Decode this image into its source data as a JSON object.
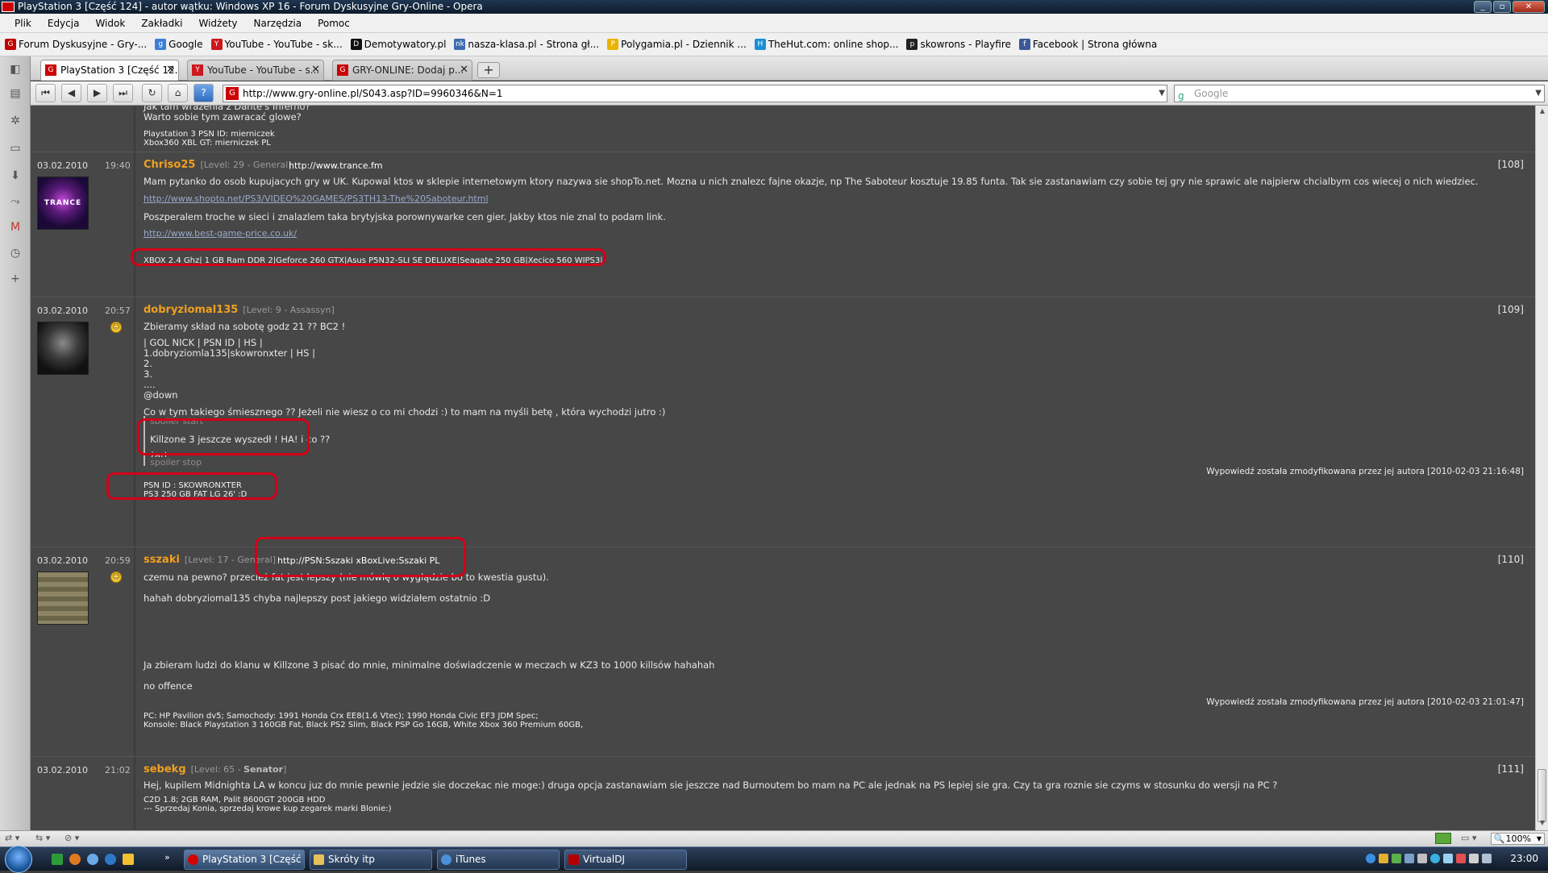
{
  "window": {
    "title": "PlayStation 3 [Część 124] - autor wątku: Windows XP 16 - Forum Dyskusyjne Gry-Online - Opera",
    "controls": [
      "_",
      "▫",
      "✕"
    ]
  },
  "menu": [
    "Plik",
    "Edycja",
    "Widok",
    "Zakładki",
    "Widżety",
    "Narzędzia",
    "Pomoc"
  ],
  "bookmarks": [
    {
      "label": "Forum Dyskusyjne - Gry-...",
      "icon": "gry-online-icon",
      "color": "#c00000"
    },
    {
      "label": "Google",
      "icon": "google-icon",
      "color": "#3a7fd5"
    },
    {
      "label": "YouTube - YouTube - sk...",
      "icon": "youtube-icon",
      "color": "#cc181e"
    },
    {
      "label": "Demotywatory.pl",
      "icon": "demotywatory-icon",
      "color": "#111111"
    },
    {
      "label": "nasza-klasa.pl - Strona gł...",
      "icon": "nk-icon",
      "color": "#3c6bb0"
    },
    {
      "label": "Polygamia.pl - Dziennik ...",
      "icon": "polygamia-icon",
      "color": "#e8b400"
    },
    {
      "label": "TheHut.com: online shop...",
      "icon": "thehut-icon",
      "color": "#1a8fd8"
    },
    {
      "label": "skowrons - Playfire",
      "icon": "playfire-icon",
      "color": "#222222"
    },
    {
      "label": "Facebook | Strona główna",
      "icon": "facebook-icon",
      "color": "#3b5998"
    }
  ],
  "tabs": [
    {
      "label": "PlayStation 3 [Część 12...",
      "active": true
    },
    {
      "label": "YouTube - YouTube - s...",
      "active": false
    },
    {
      "label": "GRY-ONLINE: Dodaj p...",
      "active": false
    }
  ],
  "address": {
    "url": "http://www.gry-online.pl/S043.asp?ID=9960346&N=1",
    "search_placeholder": "Google"
  },
  "top_partial": {
    "lines": "Jak tam wrażenia z Dante's Inferno?\nWarto sobie tym zawracać glowe?",
    "sig": "Playstation 3 PSN ID: mierniczek\nXbox360 XBL GT: mierniczek PL"
  },
  "posts": [
    {
      "date": "03.02.2010",
      "time": "19:40",
      "user": "Chriso25",
      "level": "[Level: 29 - General]",
      "site": "http://www.trance.fm",
      "num": "[108]",
      "text1": "Mam pytanko do osob kupujacych gry w UK. Kupowal ktos w sklepie internetowym ktory nazywa sie shopTo.net. Mozna u nich znalezc fajne okazje, np The Saboteur kosztuje 19.85 funta. Tak sie zastanawiam czy sobie tej gry nie sprawic ale najpierw chcialbym cos wiecej o nich wiedziec.",
      "link1": "http://www.shopto.net/PS3/VIDEO%20GAMES/PS3TH13-The%20Saboteur.html",
      "text2": "Poszperalem troche w sieci i znalazlem taka brytyjska porownywarke cen gier. Jakby ktos nie znal to podam link.",
      "link2": "http://www.best-game-price.co.uk/",
      "sig": "XBOX 2.4 Ghz| 1 GB Ram DDR 2|Geforce 260 GTX|Asus P5N32-SLI SE DELUXE|Seagate 250 GB|Xecico 560 WIPS3|"
    },
    {
      "date": "03.02.2010",
      "time": "20:57",
      "user": "dobryziomal135",
      "level": "[Level: 9 - Assassyn]",
      "num": "[109]",
      "text1": "Zbieramy skład na sobotę godz 21 ?? BC2 !",
      "table": "| GOL NICK | PSN ID | HS |\n1.dobryziomla135|skowronxter | HS |\n2.\n3.\n....",
      "text2": "@down",
      "text3": "Co w tym takiego śmiesznego ?? Jeżeli nie wiesz o co mi chodzi :) to mam na myśli betę , która wychodzi jutro :)",
      "spoiler_start": "spoiler start",
      "spoiler_text": "Killzone 3 jeszcze wyszedł ! HA! i co ??",
      "spoiler_after": "żart.",
      "spoiler_stop": "spoiler stop",
      "modified": "Wypowiedź została zmodyfikowana przez jej autora [2010-02-03 21:16:48]",
      "sig": "PSN ID : SKOWRONXTER\nPS3 250 GB FAT LG 26' :D"
    },
    {
      "date": "03.02.2010",
      "time": "20:59",
      "user": "sszaki",
      "level": "[Level: 17 - General]",
      "site": "http://PSN:Sszaki xBoxLive:Sszaki PL",
      "num": "[110]",
      "text1": "czemu na pewno? przecież fat jest lepszy (nie mówię o wyglądzie bo to kwestia gustu).",
      "text2": "hahah dobryziomal135 chyba najlepszy post jakiego widziałem ostatnio :D",
      "text3": "Ja zbieram ludzi do klanu w Killzone 3 pisać do mnie, minimalne doświadczenie w meczach w KZ3 to 1000 killsów hahahah",
      "text4": "no offence",
      "modified": "Wypowiedź została zmodyfikowana przez jej autora [2010-02-03 21:01:47]",
      "sig": "PC: HP Pavilion dv5; Samochody: 1991 Honda Crx EE8(1.6 Vtec); 1990 Honda Civic EF3 JDM Spec;\nKonsole: Black Playstation 3 160GB Fat, Black PS2 Slim, Black PSP Go 16GB, White Xbox 360 Premium 60GB,"
    },
    {
      "date": "03.02.2010",
      "time": "21:02",
      "user": "sebekg",
      "level_prefix": "[Level: 65 - ",
      "level_rank": "Senator",
      "level_suffix": "]",
      "num": "[111]",
      "text1": "Hej, kupilem Midnighta LA w koncu juz do mnie pewnie jedzie sie doczekac nie moge:) druga opcja zastanawiam sie jeszcze nad Burnoutem bo mam na PC ale jednak na PS lepiej sie gra. Czy ta gra roznie sie czyms w stosunku do wersji na PC ?",
      "sig": "C2D 1.8; 2GB RAM, Palit 8600GT 200GB HDD\n--- Sprzedaj Konia, sprzedaj krowe kup zegarek marki Blonie:)"
    }
  ],
  "status": {
    "zoom": "100%"
  },
  "taskbar": {
    "tasks": [
      {
        "label": "PlayStation 3 [Część ...",
        "icon": "opera-icon",
        "color": "#d40000",
        "active": true
      },
      {
        "label": "Skróty itp",
        "icon": "folder-icon",
        "color": "#e8c15a",
        "active": false
      },
      {
        "label": "iTunes",
        "icon": "itunes-icon",
        "color": "#4a8fd8",
        "active": false
      },
      {
        "label": "VirtualDJ",
        "icon": "virtualdj-icon",
        "color": "#b50000",
        "active": false
      }
    ],
    "clock": "23:00"
  }
}
